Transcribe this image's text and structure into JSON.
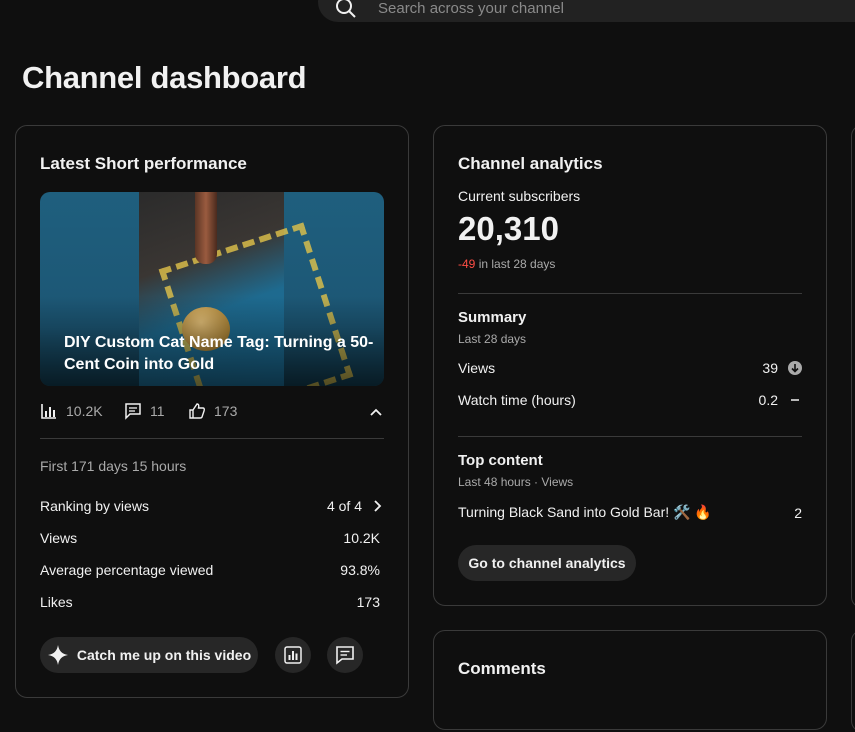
{
  "search": {
    "placeholder": "Search across your channel"
  },
  "page": {
    "title": "Channel dashboard"
  },
  "latest_short": {
    "card_title": "Latest Short performance",
    "video_title": "DIY Custom Cat Name Tag: Turning a 50-Cent Coin into Gold",
    "stats": {
      "views": "10.2K",
      "comments": "11",
      "likes": "173"
    },
    "period": "First 171 days 15 hours",
    "rows": [
      {
        "label": "Ranking by views",
        "value": "4 of 4"
      },
      {
        "label": "Views",
        "value": "10.2K"
      },
      {
        "label": "Average percentage viewed",
        "value": "93.8%"
      },
      {
        "label": "Likes",
        "value": "173"
      }
    ],
    "catch_up_label": "Catch me up on this video"
  },
  "channel_analytics": {
    "card_title": "Channel analytics",
    "subs_label": "Current subscribers",
    "subs_value": "20,310",
    "subs_change": "-49",
    "subs_change_suffix": "in last 28 days",
    "summary_title": "Summary",
    "summary_period": "Last 28 days",
    "summary_rows": [
      {
        "label": "Views",
        "value": "39"
      },
      {
        "label": "Watch time (hours)",
        "value": "0.2"
      }
    ],
    "top_title": "Top content",
    "top_period": "Last 48 hours · Views",
    "top_item": {
      "title": "Turning Black Sand into Gold Bar! 🛠️ 🔥",
      "value": "2"
    },
    "go_button": "Go to channel analytics"
  },
  "comments": {
    "card_title": "Comments"
  },
  "colors": {
    "background": "#0f0f0f",
    "card_border": "#3a3a3a",
    "negative": "#ff4e45",
    "pill_bg": "#272727"
  }
}
